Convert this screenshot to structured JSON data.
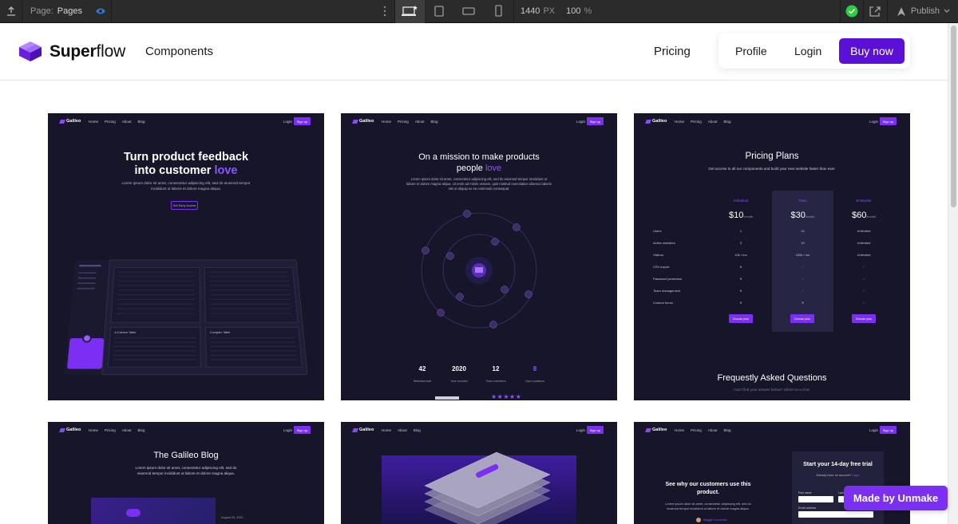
{
  "toolbar": {
    "page_label": "Page:",
    "page_value": "Pages",
    "width_value": "1440",
    "width_unit": "PX",
    "zoom_value": "100",
    "zoom_unit": "%",
    "publish_label": "Publish"
  },
  "header": {
    "logo_bold": "Super",
    "logo_rest": "flow",
    "nav_components": "Components",
    "nav_pricing": "Pricing",
    "nav_profile": "Profile",
    "nav_login": "Login",
    "nav_buy": "Buy now"
  },
  "mini_nav": {
    "brand": "Galileo",
    "links_full": [
      "Home",
      "Pricing",
      "About",
      "Blog"
    ],
    "links_short": [
      "Home",
      "About",
      "Blog"
    ],
    "login": "Login",
    "signup": "Sign up"
  },
  "cards": {
    "feedback": {
      "title_line1": "Turn product feedback",
      "title_line2_pre": "into customer ",
      "title_accent": "love",
      "blurb": "Lorem ipsum dolor sit amet, consectetur adipiscing elit, sed do eiusmod tempor incididunt ut labore et dolore magna aliqua.",
      "cta": "Get Early Access",
      "table_title_a": "4-Column Table",
      "table_title_b": "Complex Table",
      "list_title": "Checkbox Table"
    },
    "mission": {
      "title_line1": "On a mission to make products",
      "title_line2_pre": "people ",
      "title_accent": "love",
      "blurb": "Lorem ipsum dolor sit amet, consectetur adipiscing elit, sed do eiusmod tempor incididunt ut labore et dolore magna aliqua. Ut enim ad minim veniam, quis nostrud exercitation ullamco laboris nisi ut aliquip ex ea commodo consequat.",
      "stats": [
        {
          "value": "42",
          "label": "Websites built"
        },
        {
          "value": "2020",
          "label": "Year founded"
        },
        {
          "value": "12",
          "label": "Team members"
        },
        {
          "value": "8",
          "label": "Open positions"
        }
      ],
      "stars": "★★★★★"
    },
    "pricing": {
      "title": "Pricing Plans",
      "subtitle": "Get access to all our components and build your next website faster than ever.",
      "plans": [
        {
          "name": "Individual",
          "price": "$10",
          "period": "/month",
          "cta": "Choose plan"
        },
        {
          "name": "Team",
          "price": "$30",
          "period": "/month",
          "cta": "Choose plan"
        },
        {
          "name": "Enterprise",
          "price": "$60",
          "period": "/month",
          "cta": "Choose plan"
        }
      ],
      "rows": [
        {
          "label": "Users",
          "values": [
            "1",
            "10",
            "Unlimited"
          ]
        },
        {
          "label": "Active websites",
          "values": [
            "3",
            "10",
            "Unlimited"
          ]
        },
        {
          "label": "Visitors",
          "values": [
            "10k / mo",
            "100k / mo",
            "Unlimited"
          ]
        },
        {
          "label": "CSV import",
          "values": [
            "✕",
            "✓",
            "✓"
          ]
        },
        {
          "label": "Password protection",
          "values": [
            "✕",
            "✓",
            "✓"
          ]
        },
        {
          "label": "Team management",
          "values": [
            "✕",
            "✓",
            "✓"
          ]
        },
        {
          "label": "Custom forms",
          "values": [
            "✕",
            "✕",
            "✓"
          ]
        }
      ],
      "faq_title": "Frequestly Asked Questions",
      "faq_sub": "Can't find your answer below? Shoot us a chat."
    },
    "blog": {
      "title": "The Galileo Blog",
      "blurb": "Lorem ipsum dolor sit amet, consectetur adipiscing elit, sed do eiusmod tempor incididunt ut labore et dolore magna aliqua.",
      "meta": "August 20, 2022"
    },
    "trial": {
      "heading": "See why our customers use this product.",
      "blurb": "Lorem ipsum dolor sit amet, consectetur adipiscing elit, sed do eiusmod tempor incididunt ut labore et dolore magna aliqua.",
      "person": "Maggie Cummins",
      "form_title": "Start your 14-day free trial",
      "form_sub": "Already have an account?",
      "form_login": "Login",
      "first_name": "First name",
      "last_name": "Last name",
      "email": "Email address"
    }
  },
  "badge": {
    "made_by": "Made by Unmake"
  },
  "colors": {
    "brand_purple": "#5b10d6",
    "card_bg": "#16152a",
    "accent": "#8d54ff",
    "publish_ok": "#2ecc40"
  }
}
